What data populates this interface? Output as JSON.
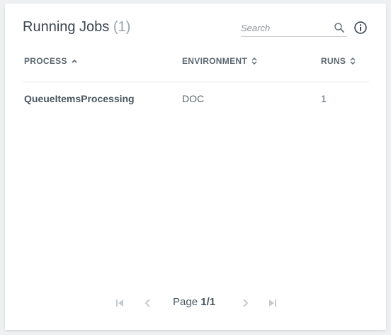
{
  "widget": {
    "title": "Running Jobs",
    "count": "(1)"
  },
  "search": {
    "placeholder": "Search",
    "value": ""
  },
  "icons": {
    "search": "search-icon",
    "info": "info-icon",
    "sort_asc": "chevron-up-icon",
    "sort_both": "sort-icon",
    "first": "first-page-icon",
    "prev": "prev-page-icon",
    "next": "next-page-icon",
    "last": "last-page-icon"
  },
  "table": {
    "columns": [
      {
        "label": "PROCESS",
        "sort": "asc"
      },
      {
        "label": "ENVIRONMENT",
        "sort": "none"
      },
      {
        "label": "RUNS",
        "sort": "none"
      }
    ],
    "rows": [
      {
        "process": "QueueItemsProcessing",
        "environment": "DOC",
        "runs": "1"
      }
    ]
  },
  "pagination": {
    "prefix": "Page",
    "current": "1",
    "separator": "/",
    "total": "1"
  },
  "colors": {
    "text_primary": "#3c4650",
    "text_muted": "#9aa2aa",
    "icon_disabled": "#c5cacf",
    "icon_active": "#6b747c"
  }
}
